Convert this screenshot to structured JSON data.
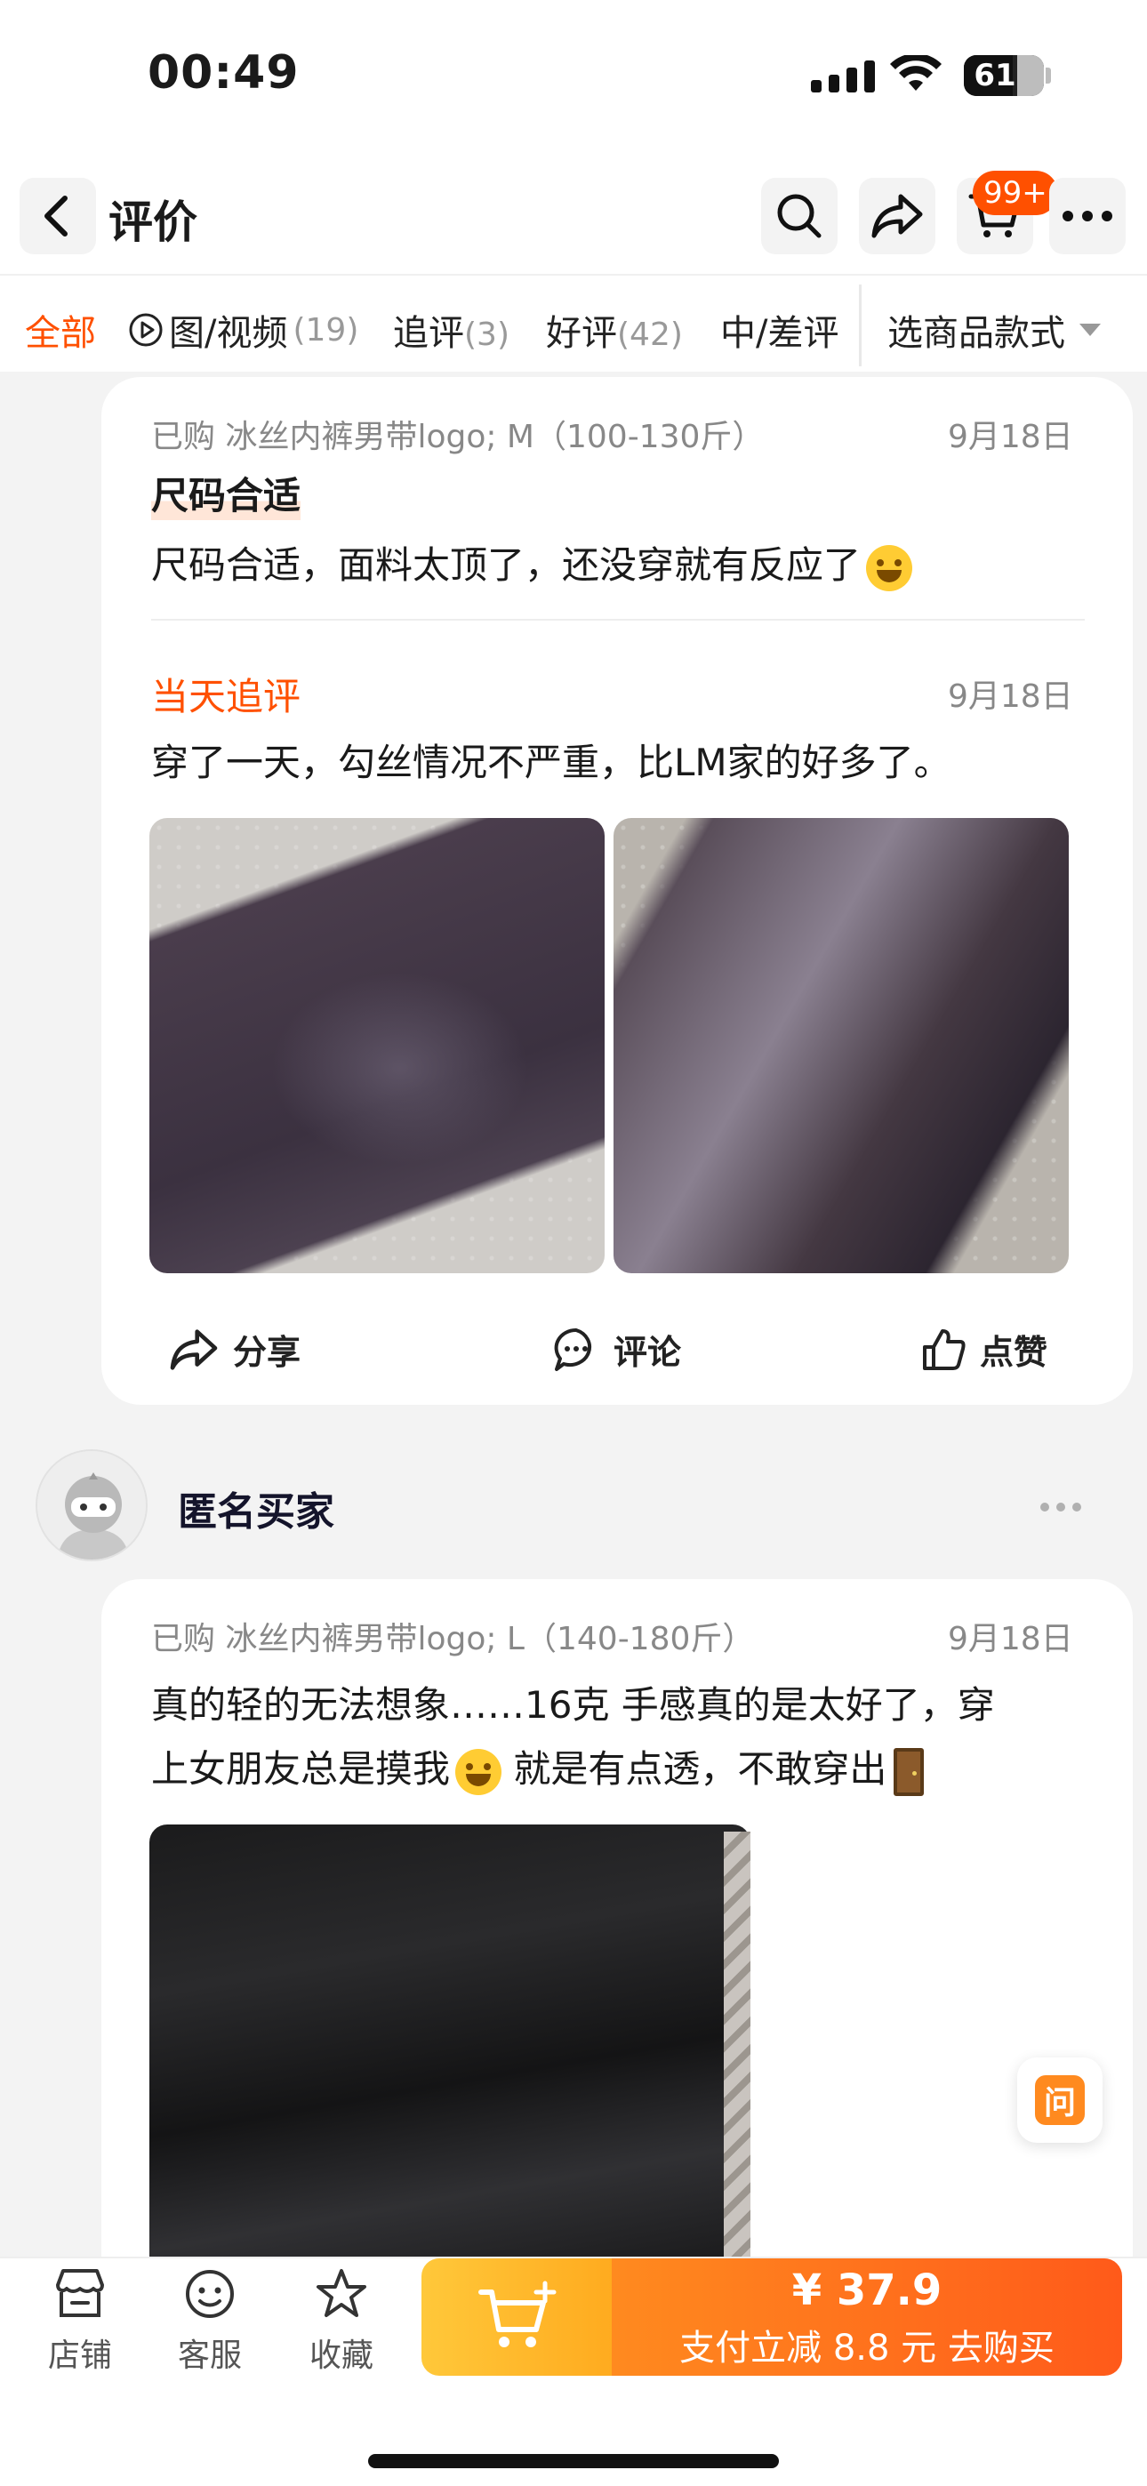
{
  "status": {
    "time": "00:49",
    "battery": "61",
    "battery_level": 0.61
  },
  "header": {
    "title": "评价",
    "cart_badge": "99+"
  },
  "filters": {
    "tabs": [
      {
        "label": "全部",
        "count": ""
      },
      {
        "label": "图/视频",
        "count": "(19)"
      },
      {
        "label": "追评",
        "count": "(3)"
      },
      {
        "label": "好评",
        "count": "(42)"
      },
      {
        "label": "中/差评",
        "count": ""
      }
    ],
    "variant_select": "选商品款式"
  },
  "review1": {
    "purchased": "已购 冰丝内裤男带logo; M（100-130斤）",
    "date": "9月18日",
    "headline": "尺码合适",
    "text": "尺码合适，面料太顶了，还没穿就有反应了",
    "followup_label": "当天追评",
    "followup_date": "9月18日",
    "followup_text": "穿了一天，勾丝情况不严重，比LM家的好多了。",
    "actions": {
      "share": "分享",
      "comment": "评论",
      "like": "点赞"
    }
  },
  "review2": {
    "username": "匿名买家",
    "purchased": "已购 冰丝内裤男带logo; L（140-180斤）",
    "date": "9月18日",
    "text_line1": "真的轻的无法想象……16克  手感真的是太好了，穿",
    "text_line2a": "上女朋友总是摸我",
    "text_line2b": " 就是有点透，不敢穿出"
  },
  "float": {
    "ask_label": "问"
  },
  "bottom": {
    "shop": "店铺",
    "service": "客服",
    "favorite": "收藏",
    "price": "¥ 37.9",
    "buy_sub": "支付立减 8.8 元  去购买"
  },
  "colors": {
    "accent": "#ff5000",
    "buy_start": "#ff8a1f",
    "cart_start": "#ffc83a"
  }
}
